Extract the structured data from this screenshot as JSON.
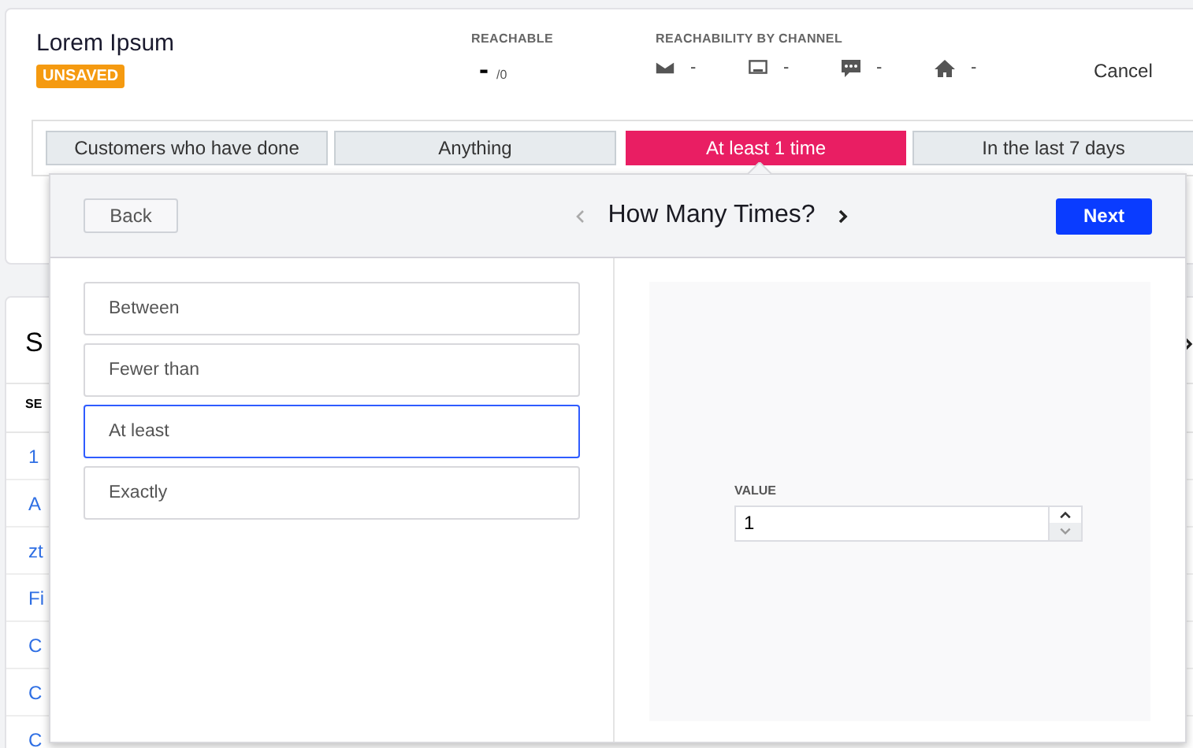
{
  "header": {
    "title": "Lorem Ipsum",
    "badge": "UNSAVED",
    "reachable": {
      "label": "REACHABLE",
      "value": "-",
      "total": "/0"
    },
    "reachability_by_channel": {
      "label": "REACHABILITY BY CHANNEL",
      "channels": [
        {
          "kind": "email",
          "value": "-"
        },
        {
          "kind": "screen",
          "value": "-"
        },
        {
          "kind": "chat",
          "value": "-"
        },
        {
          "kind": "home",
          "value": "-"
        }
      ]
    },
    "cancel": "Cancel"
  },
  "filter_chips": [
    {
      "label": "Customers who have done",
      "selected": false
    },
    {
      "label": "Anything",
      "selected": false
    },
    {
      "label": "At least 1 time",
      "selected": true
    },
    {
      "label": "In the last 7 days",
      "selected": false
    }
  ],
  "background_list": {
    "heading": "S",
    "column_1": "SE",
    "rows": [
      "1",
      "A",
      "zt",
      "Fi",
      "C",
      "C",
      "C"
    ]
  },
  "popover": {
    "back": "Back",
    "title": "How Many Times?",
    "next": "Next",
    "options": [
      {
        "label": "Between",
        "selected": false
      },
      {
        "label": "Fewer than",
        "selected": false
      },
      {
        "label": "At least",
        "selected": true
      },
      {
        "label": "Exactly",
        "selected": false
      }
    ],
    "value_field": {
      "label": "VALUE",
      "value": "1"
    }
  }
}
